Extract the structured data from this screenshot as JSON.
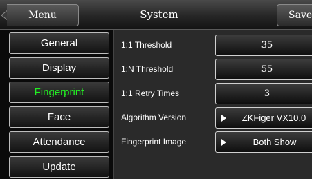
{
  "header": {
    "title": "System",
    "menu_label": "Menu",
    "save_label": "Save"
  },
  "tabs": [
    {
      "label": "General"
    },
    {
      "label": "Display"
    },
    {
      "label": "Fingerprint",
      "active": true
    },
    {
      "label": "Face"
    },
    {
      "label": "Attendance"
    },
    {
      "label": "Update"
    }
  ],
  "active_tab_color": "#22ee22",
  "settings": [
    {
      "label": "1:1 Threshold",
      "value": "35"
    },
    {
      "label": "1:N Threshold",
      "value": "55"
    },
    {
      "label": "1:1 Retry Times",
      "value": "3"
    },
    {
      "label": "Algorithm Version",
      "value": "ZKFiger VX10.0",
      "icon": "triangle-right-icon"
    },
    {
      "label": "Fingerprint Image",
      "value": "Both Show",
      "icon": "triangle-right-icon"
    }
  ]
}
